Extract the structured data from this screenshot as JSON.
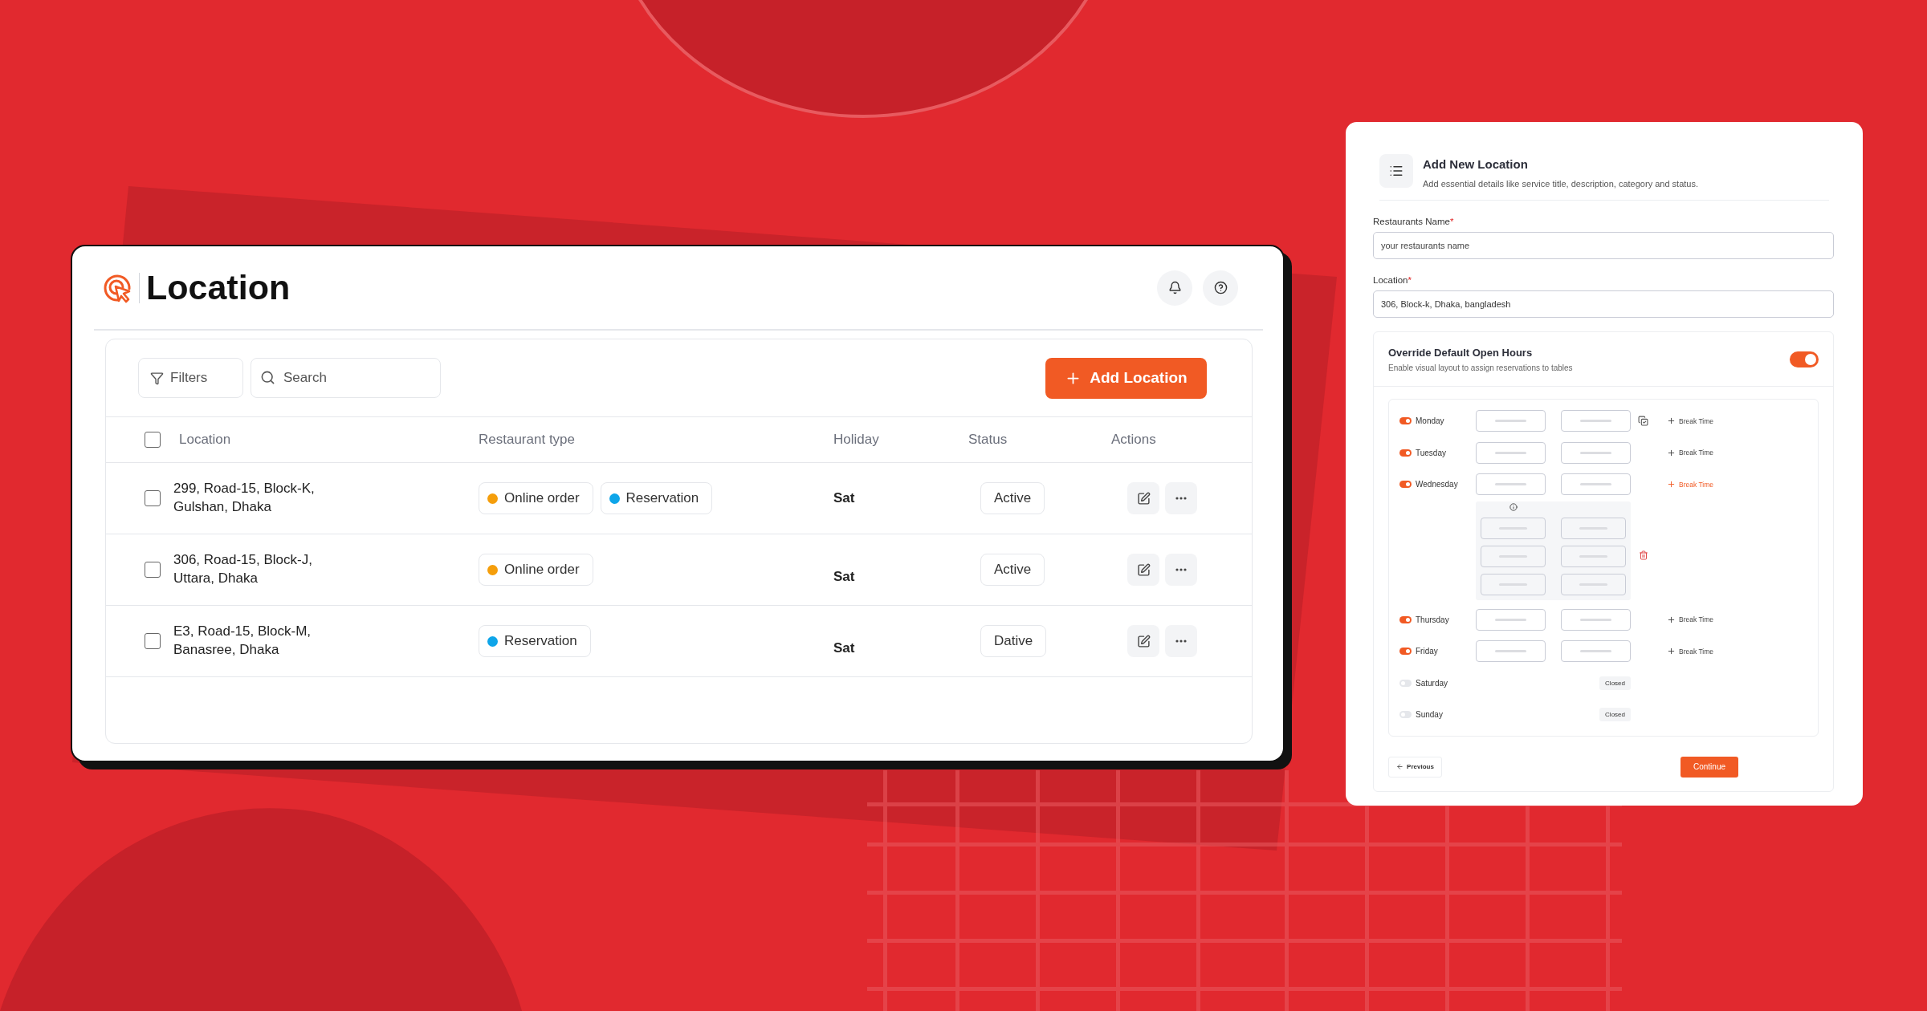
{
  "location_page": {
    "title": "Location",
    "toolbar": {
      "filters": "Filters",
      "search": {
        "placeholder": "Search"
      },
      "add_button": "Add Location"
    },
    "table": {
      "select_all": {
        "checked": false
      },
      "columns": [
        "Location",
        "Restaurant type",
        "Holiday",
        "Status",
        "Actions"
      ],
      "rows": [
        {
          "checked": false,
          "location": "299, Road-15, Block-K,\nGulshan, Dhaka",
          "types": [
            {
              "label": "Online order",
              "color": "#f59e0b"
            },
            {
              "label": "Reservation",
              "color": "#0ea5e9"
            }
          ],
          "holiday": "Sat",
          "status": "Active"
        },
        {
          "checked": false,
          "location": "306, Road-15, Block-J,\nUttara, Dhaka",
          "types": [
            {
              "label": "Online order",
              "color": "#f59e0b"
            }
          ],
          "holiday": "Sat",
          "status": "Active"
        },
        {
          "checked": false,
          "location": "E3, Road-15, Block-M,\nBanasree, Dhaka",
          "types": [
            {
              "label": "Reservation",
              "color": "#0ea5e9"
            }
          ],
          "holiday": "Sat",
          "status": "Dative"
        }
      ]
    }
  },
  "add_location": {
    "title": "Add New Location",
    "subtitle": "Add essential details like service title, description, category and status.",
    "fields": [
      {
        "label": "Restaurants Name",
        "required_mark": "*",
        "placeholder": "your restaurants name"
      },
      {
        "label": "Location",
        "required_mark": "*",
        "value": "306, Block-k, Dhaka, bangladesh"
      }
    ],
    "override": {
      "title": "Override Default Open Hours",
      "subtitle": "Enable visual layout to assign reservations to tables",
      "on": true
    },
    "days": [
      {
        "name": "Monday",
        "on": true,
        "kind": "hours",
        "break_label": "Break Time",
        "copy": true,
        "expanded": false
      },
      {
        "name": "Tuesday",
        "on": true,
        "kind": "hours",
        "break_label": "Break Time",
        "copy": false,
        "expanded": false
      },
      {
        "name": "Wednesday",
        "on": true,
        "kind": "hours",
        "break_label": "Break Time",
        "copy": false,
        "expanded": true
      },
      {
        "name": "Thursday",
        "on": true,
        "kind": "hours",
        "break_label": "Break Time",
        "copy": false,
        "expanded": false
      },
      {
        "name": "Friday",
        "on": true,
        "kind": "hours",
        "break_label": "Break Time",
        "copy": false,
        "expanded": false
      },
      {
        "name": "Saturday",
        "on": false,
        "kind": "closed",
        "closed_label": "Closed"
      },
      {
        "name": "Sunday",
        "on": false,
        "kind": "closed",
        "closed_label": "Closed"
      }
    ],
    "previous": "Previous",
    "continue": "Continue"
  }
}
